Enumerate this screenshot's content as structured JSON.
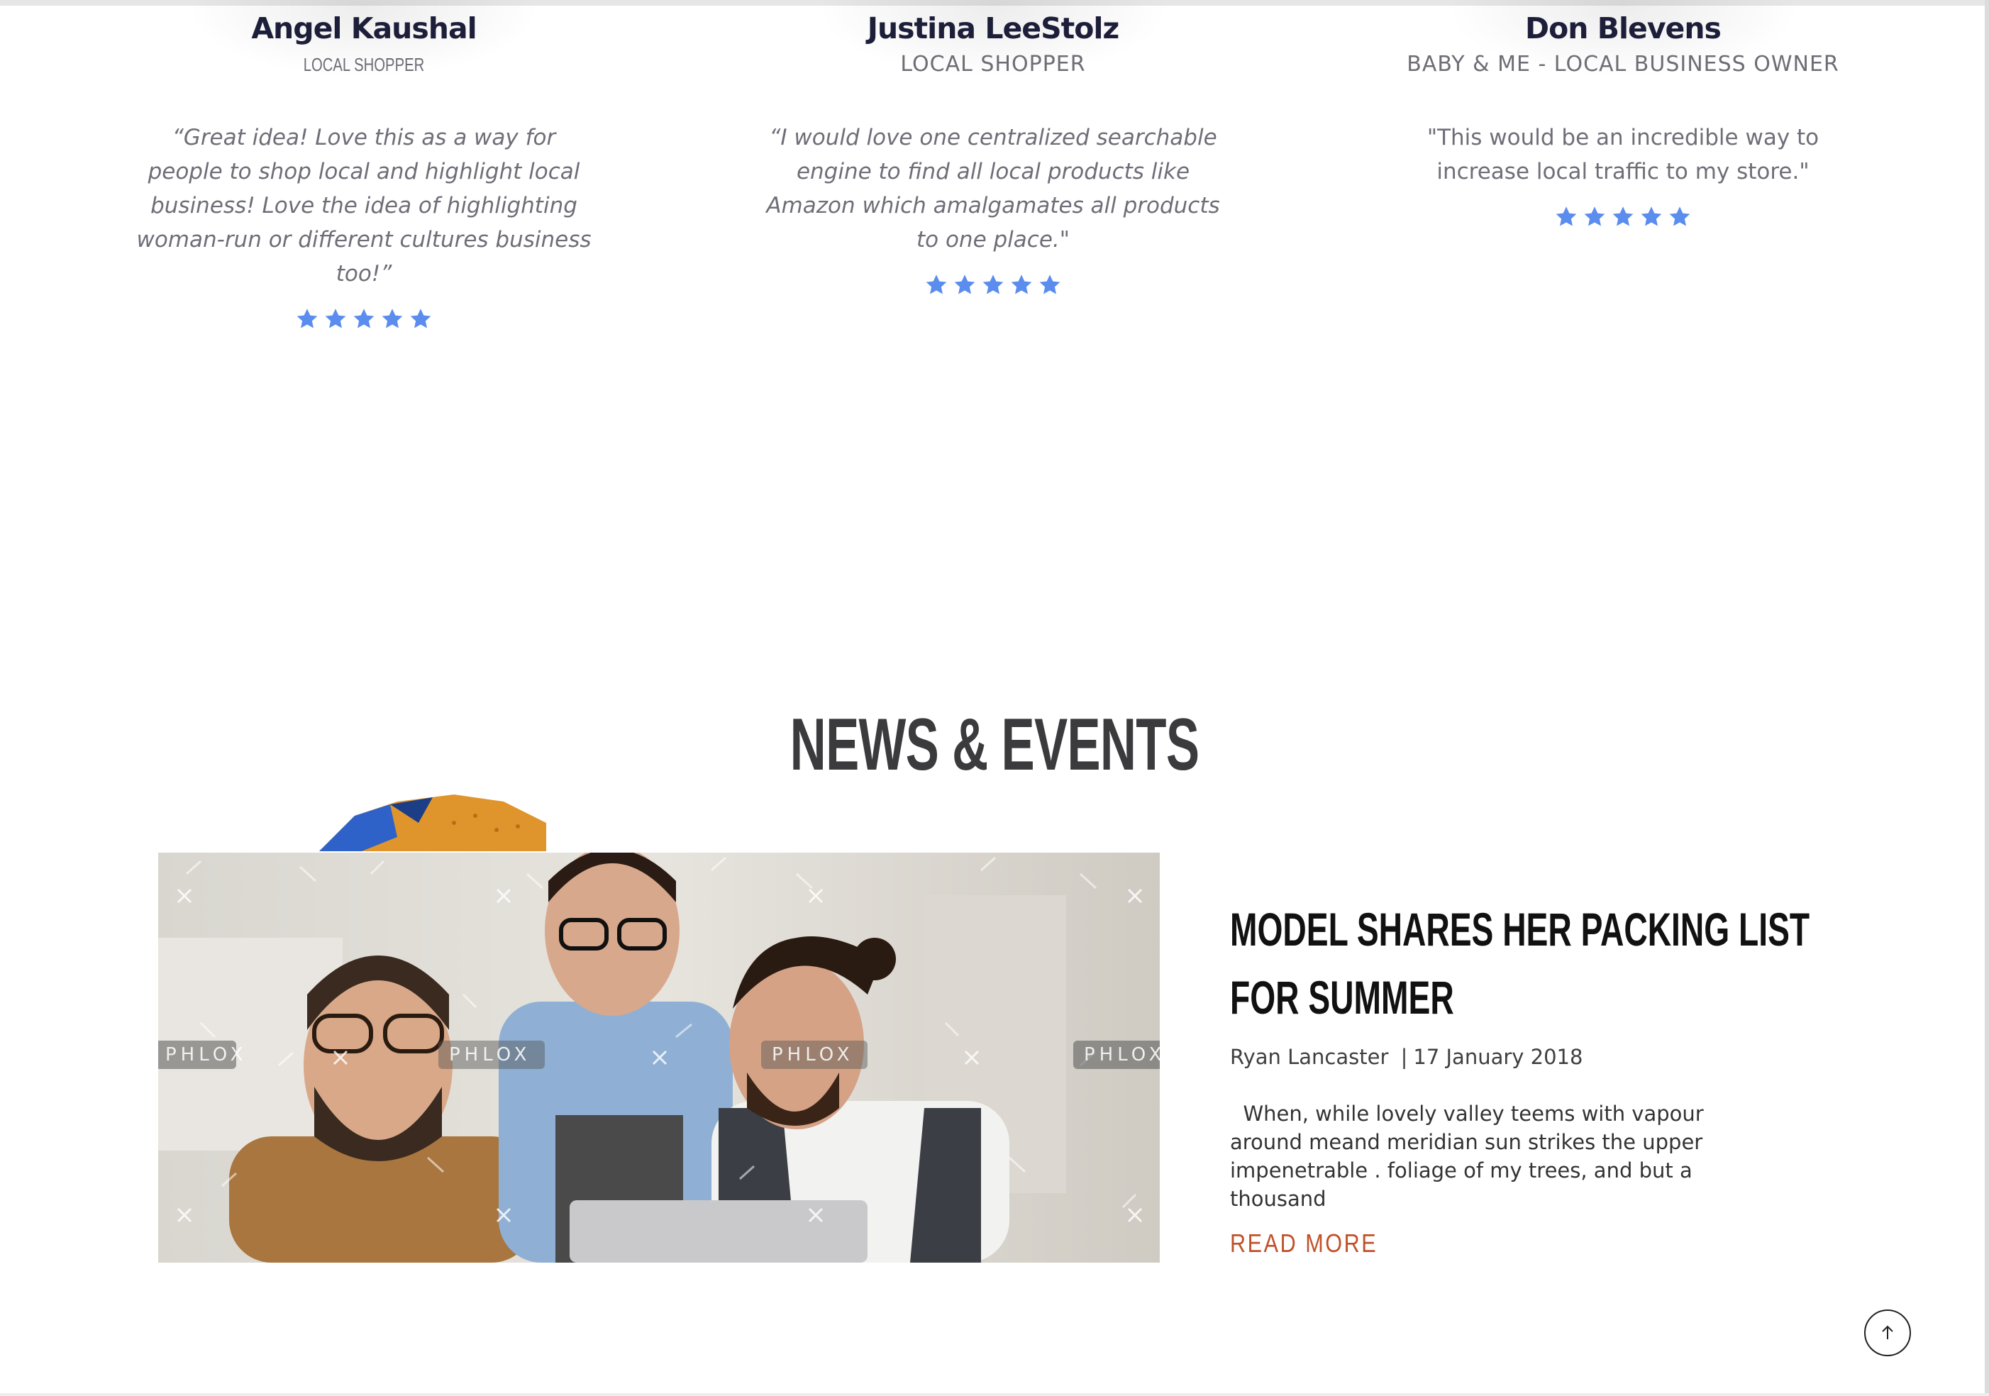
{
  "testimonials": [
    {
      "name": "Angel Kaushal",
      "role": "LOCAL SHOPPER",
      "quote": "“Great idea! Love this as a way for people to shop local and highlight local business! Love the idea of highlighting woman-run or different cultures business too!”",
      "rating": 5
    },
    {
      "name": "Justina LeeStolz",
      "role": "LOCAL SHOPPER",
      "quote": "“I would love one centralized searchable engine to find all local products like Amazon which amalgamates all products to one place.\"",
      "rating": 5
    },
    {
      "name": "Don Blevens",
      "role": "BABY & ME - LOCAL BUSINESS OWNER",
      "quote": "\"This would be an incredible way to increase local traffic to my store.\"",
      "rating": 5
    }
  ],
  "news": {
    "heading": "NEWS & EVENTS",
    "post": {
      "title": "MODEL SHARES HER PACKING LIST FOR SUMMER",
      "author": "Ryan Lancaster",
      "separator": "|",
      "date": "17 January 2018",
      "excerpt": "  When, while lovely valley teems with vapour around meand meridian sun strikes the upper impenetrable . foliage of my trees, and but a thousand",
      "read_more": "READ MORE",
      "image_watermark": "PHLOX"
    }
  },
  "colors": {
    "star": "#5b8def",
    "name": "#1d1f3a",
    "read_more": "#c0502a",
    "heading": "#3b3b3d"
  },
  "icons": {
    "star": "star-icon",
    "scroll_top": "arrow-up-icon"
  }
}
